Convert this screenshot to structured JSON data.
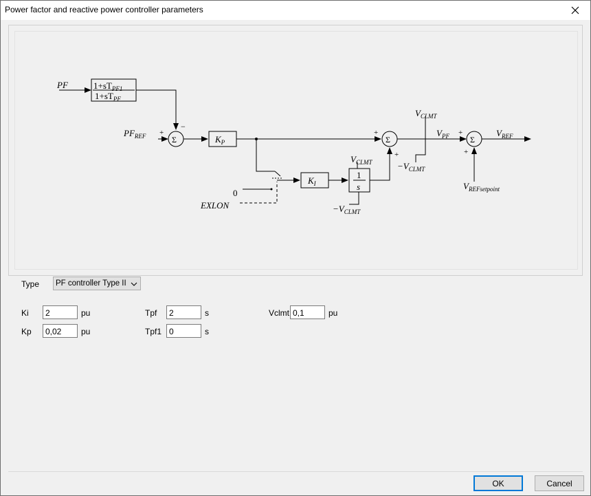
{
  "window": {
    "title": "Power factor and reactive power controller parameters"
  },
  "diagram": {
    "pf": "PF",
    "filter_num": "1+sT",
    "filter_num_sub": "PF1",
    "filter_den": "1+sT",
    "filter_den_sub": "PF",
    "pf_ref": "PF",
    "pf_ref_sub": "REF",
    "plus": "+",
    "minus": "−",
    "sigma": "Σ",
    "kp": "K",
    "kp_sub": "P",
    "ki": "K",
    "ki_sub": "I",
    "int_num": "1",
    "int_den": "s",
    "vclmt": "V",
    "vclmt_sub": "CLMT",
    "neg_vclmt": "−V",
    "zero": "0",
    "exlon": "EXLON",
    "vpf": "V",
    "vpf_sub": "PF",
    "vref": "V",
    "vref_sub": "REF",
    "vref_sp": "V",
    "vref_sp_sub": "REFsetpoint"
  },
  "form": {
    "type_label": "Type",
    "type_value": "PF controller Type II",
    "ki_label": "Ki",
    "ki_value": "2",
    "ki_unit": "pu",
    "kp_label": "Kp",
    "kp_value": "0,02",
    "kp_unit": "pu",
    "tpf_label": "Tpf",
    "tpf_value": "2",
    "tpf_unit": "s",
    "tpf1_label": "Tpf1",
    "tpf1_value": "0",
    "tpf1_unit": "s",
    "vclmt_label": "Vclmt",
    "vclmt_value": "0,1",
    "vclmt_unit": "pu"
  },
  "buttons": {
    "ok": "OK",
    "cancel": "Cancel"
  }
}
